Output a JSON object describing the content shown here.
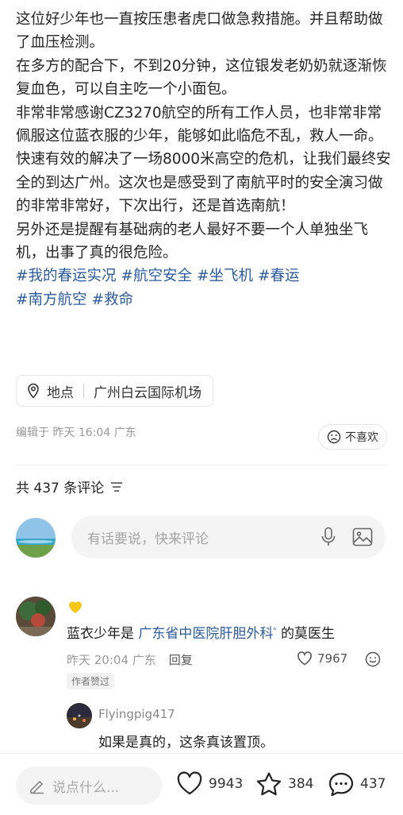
{
  "post": {
    "paragraphs": [
      "这位好少年也一直按压患者虎口做急救措施。并且帮助做了血压检测。",
      "在多方的配合下，不到20分钟，这位银发老奶奶就逐渐恢复血色，可以自主吃一个小面包。",
      "非常非常感谢CZ3270航空的所有工作人员，也非常非常佩服这位蓝衣服的少年，能够如此临危不乱，救人一命。",
      "快速有效的解决了一场8000米高空的危机，让我们最终安全的到达广州。这次也是感受到了南航平时的安全演习做的非常非常好，下次出行，还是首选南航！",
      "另外还是提醒有基础病的老人最好不要一个人单独坐飞机，出事了真的很危险。"
    ],
    "tags": [
      "#我的春运实况",
      "#航空安全",
      "#坐飞机",
      "#春运",
      "#南方航空",
      "#救命"
    ],
    "location_label": "地点",
    "location_value": "广州白云国际机场",
    "meta": "编辑于 昨天 16:04 广东",
    "dislike_label": "不喜欢"
  },
  "comments_header": {
    "text": "共 437 条评论"
  },
  "comment_input": {
    "placeholder": "有话要说，快来评论"
  },
  "top_comment": {
    "text_prefix": "蓝衣少年是 ",
    "link_text": "广东省中医院肝胆外科",
    "link_sup": "ᵒ",
    "text_suffix": " 的莫医生",
    "time_location": "昨天 20:04 广东",
    "reply_label": "回复",
    "likes": "7967",
    "author_badge": "作者赞过",
    "reply": {
      "username": "Flyingpig417",
      "text": "如果是真的，这条真该置顶。"
    }
  },
  "bottom_bar": {
    "input_placeholder": "说点什么...",
    "likes": "9943",
    "stars": "384",
    "comments": "437"
  },
  "colors": {
    "link": "#2b5b9e",
    "muted": "#999999",
    "badge_heart": "#f5c518"
  }
}
